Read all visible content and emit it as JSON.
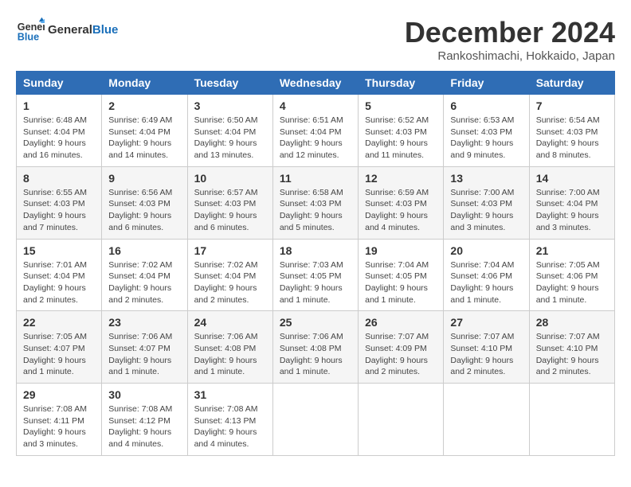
{
  "header": {
    "logo_text_general": "General",
    "logo_text_blue": "Blue",
    "month_title": "December 2024",
    "location": "Rankoshimachi, Hokkaido, Japan"
  },
  "calendar": {
    "days_of_week": [
      "Sunday",
      "Monday",
      "Tuesday",
      "Wednesday",
      "Thursday",
      "Friday",
      "Saturday"
    ],
    "weeks": [
      [
        {
          "day": "1",
          "sunrise": "6:48 AM",
          "sunset": "4:04 PM",
          "daylight": "9 hours and 16 minutes."
        },
        {
          "day": "2",
          "sunrise": "6:49 AM",
          "sunset": "4:04 PM",
          "daylight": "9 hours and 14 minutes."
        },
        {
          "day": "3",
          "sunrise": "6:50 AM",
          "sunset": "4:04 PM",
          "daylight": "9 hours and 13 minutes."
        },
        {
          "day": "4",
          "sunrise": "6:51 AM",
          "sunset": "4:04 PM",
          "daylight": "9 hours and 12 minutes."
        },
        {
          "day": "5",
          "sunrise": "6:52 AM",
          "sunset": "4:03 PM",
          "daylight": "9 hours and 11 minutes."
        },
        {
          "day": "6",
          "sunrise": "6:53 AM",
          "sunset": "4:03 PM",
          "daylight": "9 hours and 9 minutes."
        },
        {
          "day": "7",
          "sunrise": "6:54 AM",
          "sunset": "4:03 PM",
          "daylight": "9 hours and 8 minutes."
        }
      ],
      [
        {
          "day": "8",
          "sunrise": "6:55 AM",
          "sunset": "4:03 PM",
          "daylight": "9 hours and 7 minutes."
        },
        {
          "day": "9",
          "sunrise": "6:56 AM",
          "sunset": "4:03 PM",
          "daylight": "9 hours and 6 minutes."
        },
        {
          "day": "10",
          "sunrise": "6:57 AM",
          "sunset": "4:03 PM",
          "daylight": "9 hours and 6 minutes."
        },
        {
          "day": "11",
          "sunrise": "6:58 AM",
          "sunset": "4:03 PM",
          "daylight": "9 hours and 5 minutes."
        },
        {
          "day": "12",
          "sunrise": "6:59 AM",
          "sunset": "4:03 PM",
          "daylight": "9 hours and 4 minutes."
        },
        {
          "day": "13",
          "sunrise": "7:00 AM",
          "sunset": "4:03 PM",
          "daylight": "9 hours and 3 minutes."
        },
        {
          "day": "14",
          "sunrise": "7:00 AM",
          "sunset": "4:04 PM",
          "daylight": "9 hours and 3 minutes."
        }
      ],
      [
        {
          "day": "15",
          "sunrise": "7:01 AM",
          "sunset": "4:04 PM",
          "daylight": "9 hours and 2 minutes."
        },
        {
          "day": "16",
          "sunrise": "7:02 AM",
          "sunset": "4:04 PM",
          "daylight": "9 hours and 2 minutes."
        },
        {
          "day": "17",
          "sunrise": "7:02 AM",
          "sunset": "4:04 PM",
          "daylight": "9 hours and 2 minutes."
        },
        {
          "day": "18",
          "sunrise": "7:03 AM",
          "sunset": "4:05 PM",
          "daylight": "9 hours and 1 minute."
        },
        {
          "day": "19",
          "sunrise": "7:04 AM",
          "sunset": "4:05 PM",
          "daylight": "9 hours and 1 minute."
        },
        {
          "day": "20",
          "sunrise": "7:04 AM",
          "sunset": "4:06 PM",
          "daylight": "9 hours and 1 minute."
        },
        {
          "day": "21",
          "sunrise": "7:05 AM",
          "sunset": "4:06 PM",
          "daylight": "9 hours and 1 minute."
        }
      ],
      [
        {
          "day": "22",
          "sunrise": "7:05 AM",
          "sunset": "4:07 PM",
          "daylight": "9 hours and 1 minute."
        },
        {
          "day": "23",
          "sunrise": "7:06 AM",
          "sunset": "4:07 PM",
          "daylight": "9 hours and 1 minute."
        },
        {
          "day": "24",
          "sunrise": "7:06 AM",
          "sunset": "4:08 PM",
          "daylight": "9 hours and 1 minute."
        },
        {
          "day": "25",
          "sunrise": "7:06 AM",
          "sunset": "4:08 PM",
          "daylight": "9 hours and 1 minute."
        },
        {
          "day": "26",
          "sunrise": "7:07 AM",
          "sunset": "4:09 PM",
          "daylight": "9 hours and 2 minutes."
        },
        {
          "day": "27",
          "sunrise": "7:07 AM",
          "sunset": "4:10 PM",
          "daylight": "9 hours and 2 minutes."
        },
        {
          "day": "28",
          "sunrise": "7:07 AM",
          "sunset": "4:10 PM",
          "daylight": "9 hours and 2 minutes."
        }
      ],
      [
        {
          "day": "29",
          "sunrise": "7:08 AM",
          "sunset": "4:11 PM",
          "daylight": "9 hours and 3 minutes."
        },
        {
          "day": "30",
          "sunrise": "7:08 AM",
          "sunset": "4:12 PM",
          "daylight": "9 hours and 4 minutes."
        },
        {
          "day": "31",
          "sunrise": "7:08 AM",
          "sunset": "4:13 PM",
          "daylight": "9 hours and 4 minutes."
        },
        null,
        null,
        null,
        null
      ]
    ]
  }
}
